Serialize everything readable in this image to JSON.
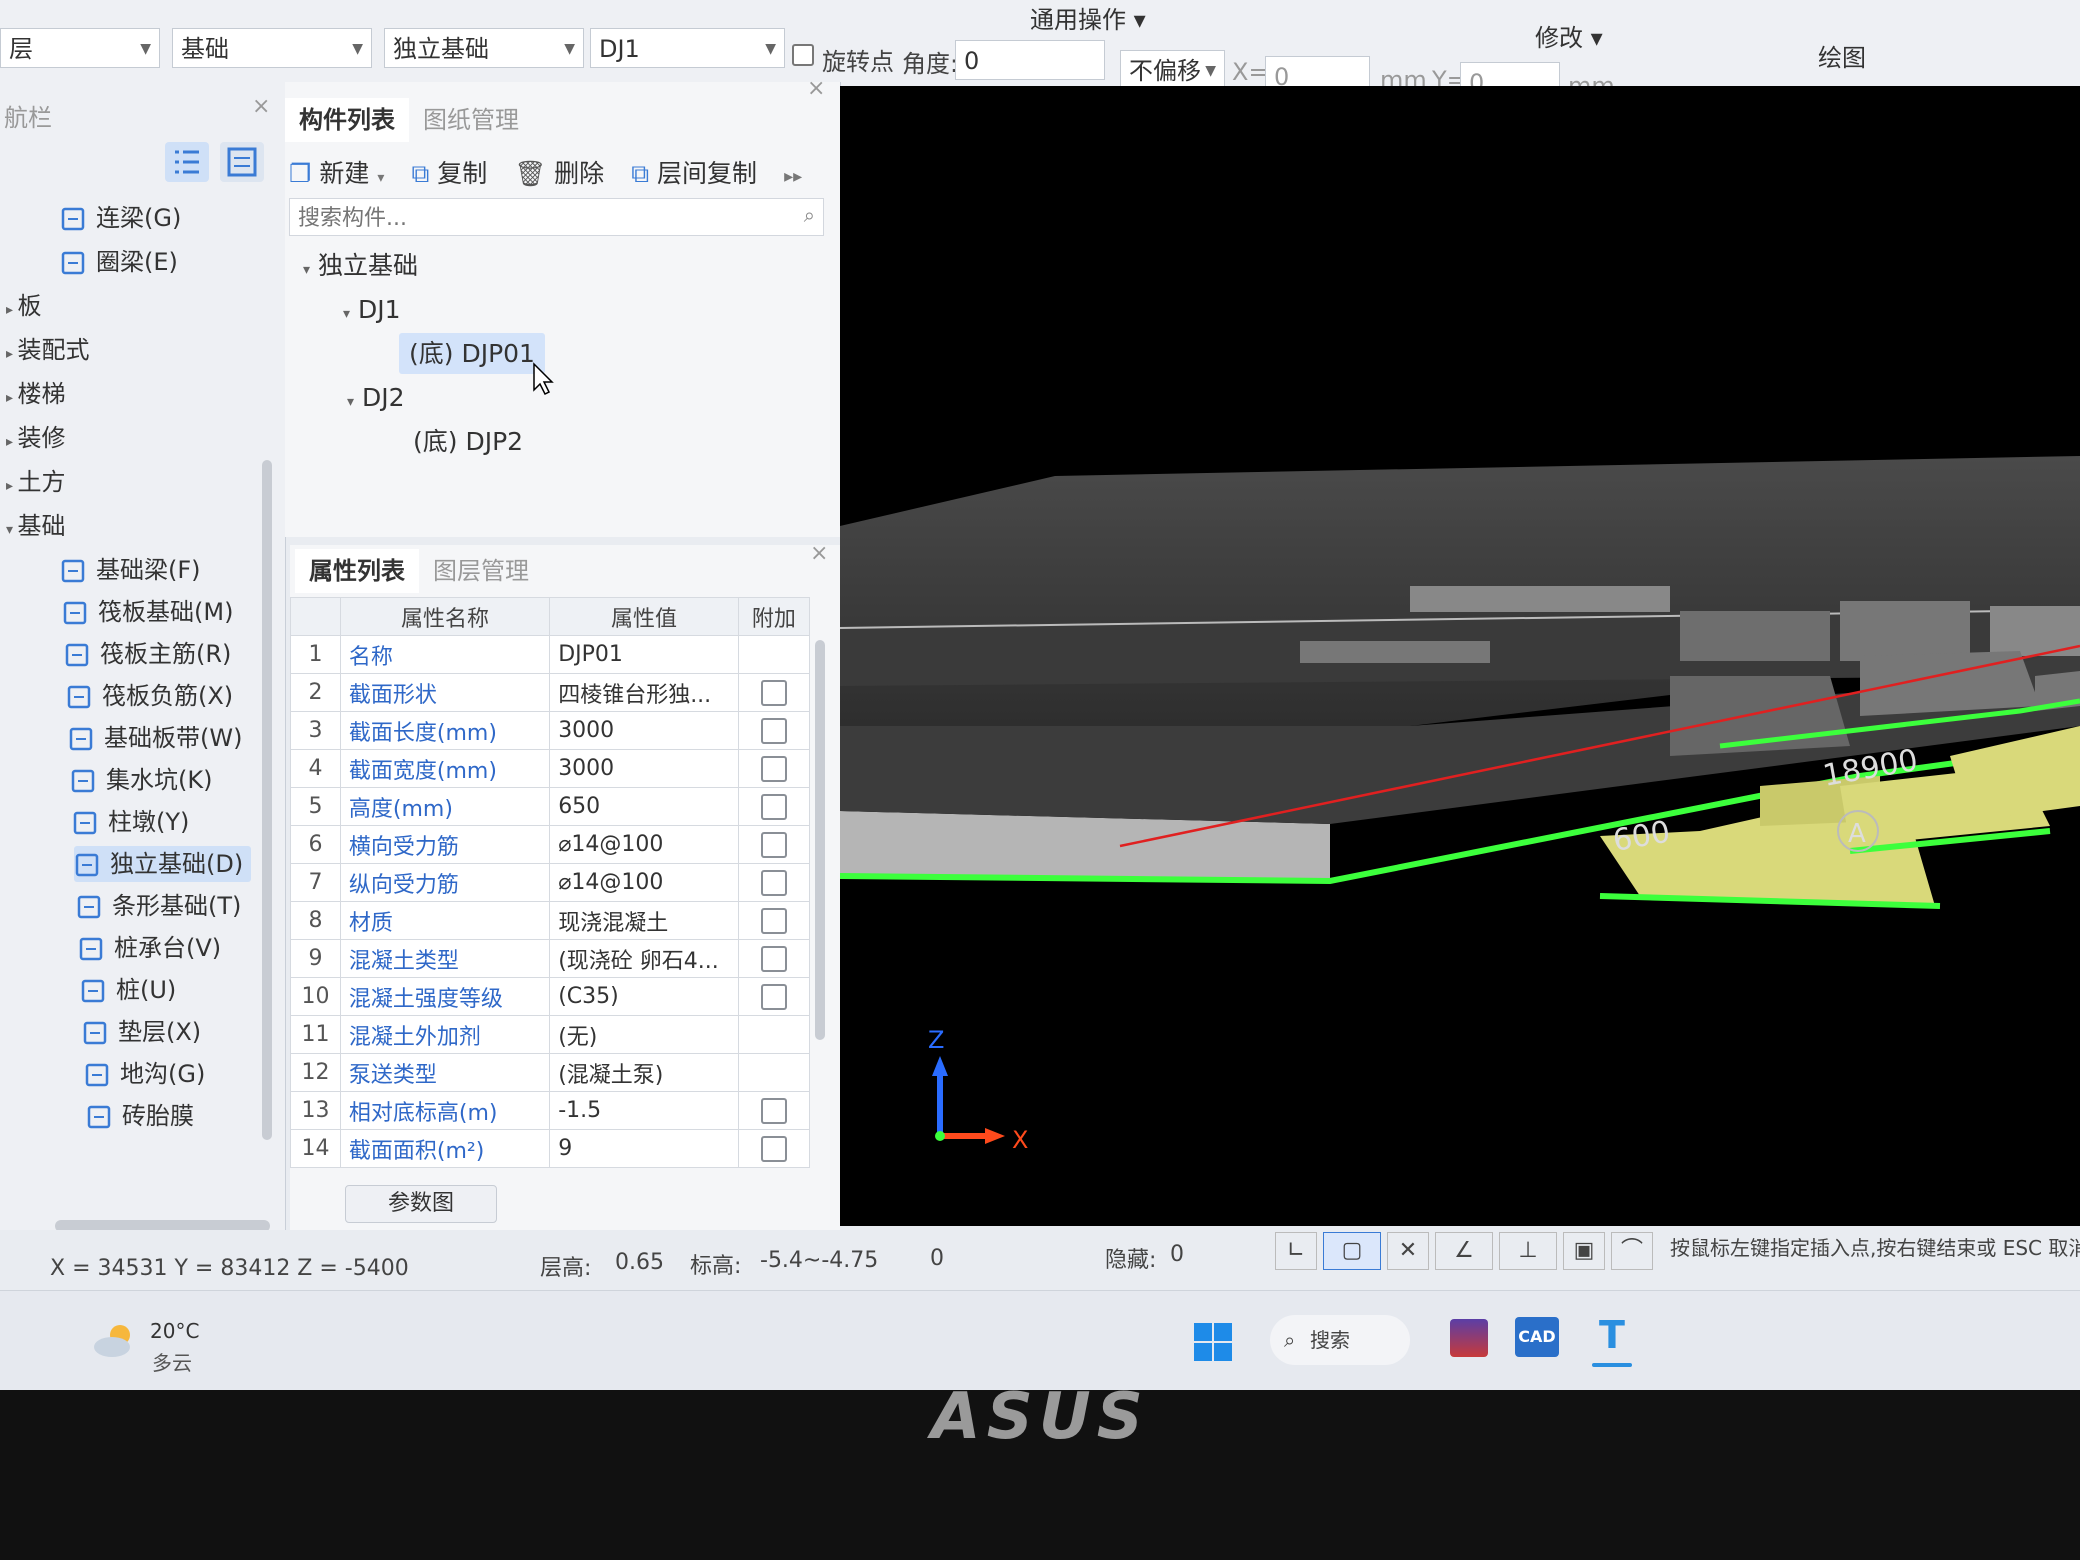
{
  "ribbon": {
    "menus": [
      "通用操作",
      "修改",
      "绘图"
    ],
    "floor_combo": "层",
    "category_combo": "基础",
    "type_combo": "独立基础",
    "component_combo": "DJ1",
    "rotate_label": "旋转点",
    "angle_label": "角度:",
    "angle_value": "0",
    "offset_combo": "不偏移",
    "x_label": "X=",
    "x_value": "0",
    "unit_mm": "mm",
    "y_label": "Y=",
    "y_value": "0"
  },
  "nav": {
    "title": "航栏",
    "items": [
      {
        "label": "连梁(G)",
        "icon": "lintel-beam-icon",
        "indent": 2
      },
      {
        "label": "圈梁(E)",
        "icon": "ring-beam-icon",
        "indent": 2
      },
      {
        "label": "板",
        "indent": 0,
        "collapsed": true
      },
      {
        "label": "装配式",
        "indent": 0,
        "collapsed": true
      },
      {
        "label": "楼梯",
        "indent": 0,
        "collapsed": true
      },
      {
        "label": "装修",
        "indent": 0,
        "collapsed": true
      },
      {
        "label": "土方",
        "indent": 0,
        "collapsed": true
      },
      {
        "label": "基础",
        "indent": 0,
        "expanded": true
      },
      {
        "label": "基础梁(F)",
        "icon": "foundation-beam-icon",
        "indent": 2
      },
      {
        "label": "筏板基础(M)",
        "icon": "raft-foundation-icon",
        "indent": 2
      },
      {
        "label": "筏板主筋(R)",
        "icon": "raft-main-rebar-icon",
        "indent": 2
      },
      {
        "label": "筏板负筋(X)",
        "icon": "raft-neg-rebar-icon",
        "indent": 2
      },
      {
        "label": "基础板带(W)",
        "icon": "foundation-strip-icon",
        "indent": 2
      },
      {
        "label": "集水坑(K)",
        "icon": "sump-pit-icon",
        "indent": 2
      },
      {
        "label": "柱墩(Y)",
        "icon": "column-pier-icon",
        "indent": 2
      },
      {
        "label": "独立基础(D)",
        "icon": "isolated-footing-icon",
        "indent": 2,
        "selected": true
      },
      {
        "label": "条形基础(T)",
        "icon": "strip-footing-icon",
        "indent": 2
      },
      {
        "label": "桩承台(V)",
        "icon": "pile-cap-icon",
        "indent": 2
      },
      {
        "label": "桩(U)",
        "icon": "pile-icon",
        "indent": 2
      },
      {
        "label": "垫层(X)",
        "icon": "cushion-icon",
        "indent": 2
      },
      {
        "label": "地沟(G)",
        "icon": "trench-icon",
        "indent": 2
      },
      {
        "label": "砖胎膜",
        "icon": "brick-mold-icon",
        "indent": 2
      }
    ]
  },
  "component_panel": {
    "tabs": [
      "构件列表",
      "图纸管理"
    ],
    "toolbar": {
      "new": "新建",
      "copy": "复制",
      "delete": "删除",
      "floor_copy": "层间复制"
    },
    "search_placeholder": "搜索构件...",
    "tree": {
      "root": "独立基础",
      "groups": [
        {
          "name": "DJ1",
          "children": [
            "(底) DJP01"
          ]
        },
        {
          "name": "DJ2",
          "children": [
            "(底) DJP2"
          ]
        }
      ]
    }
  },
  "property_panel": {
    "tabs": [
      "属性列表",
      "图层管理"
    ],
    "columns": [
      "属性名称",
      "属性值",
      "附加"
    ],
    "rows": [
      {
        "n": "1",
        "name": "名称",
        "value": "DJP01",
        "check": false
      },
      {
        "n": "2",
        "name": "截面形状",
        "value": "四棱锥台形独...",
        "check": true
      },
      {
        "n": "3",
        "name": "截面长度(mm)",
        "value": "3000",
        "check": true
      },
      {
        "n": "4",
        "name": "截面宽度(mm)",
        "value": "3000",
        "check": true
      },
      {
        "n": "5",
        "name": "高度(mm)",
        "value": "650",
        "check": true
      },
      {
        "n": "6",
        "name": "横向受力筋",
        "value": "⌀14@100",
        "check": true
      },
      {
        "n": "7",
        "name": "纵向受力筋",
        "value": "⌀14@100",
        "check": true
      },
      {
        "n": "8",
        "name": "材质",
        "value": "现浇混凝土",
        "check": true
      },
      {
        "n": "9",
        "name": "混凝土类型",
        "value": "(现浇砼 卵石4...",
        "check": true
      },
      {
        "n": "10",
        "name": "混凝土强度等级",
        "value": "(C35)",
        "check": true
      },
      {
        "n": "11",
        "name": "混凝土外加剂",
        "value": "(无)",
        "check": false
      },
      {
        "n": "12",
        "name": "泵送类型",
        "value": "(混凝土泵)",
        "check": false
      },
      {
        "n": "13",
        "name": "相对底标高(m)",
        "value": "-1.5",
        "check": true
      },
      {
        "n": "14",
        "name": "截面面积(m²)",
        "value": "9",
        "check": true
      }
    ],
    "param_button": "参数图"
  },
  "viewport": {
    "dim_labels": [
      "18900",
      "600",
      "A"
    ],
    "axis_z": "Z",
    "axis_x": "X"
  },
  "status": {
    "coords": "X = 34531 Y = 83412 Z = -5400",
    "floor_height_label": "层高:",
    "floor_height": "0.65",
    "elevation_label": "标高:",
    "elevation": "-5.4~-4.75",
    "extra": "0",
    "hidden_label": "隐藏:",
    "hidden": "0",
    "hint": "按鼠标左键指定插入点,按右键结束或 ESC 取消"
  },
  "taskbar": {
    "weather_temp": "20°C",
    "weather_desc": "多云",
    "search_label": "搜索",
    "apps": [
      "winrar-icon",
      "cad-icon",
      "t-app-icon"
    ]
  },
  "laptop": {
    "brand": "ASUS"
  },
  "colors": {
    "accent_blue": "#2f68c8",
    "viewport_bg": "#000000",
    "green_edge": "#3cff3c",
    "footing_yellow": "#d9d97a"
  }
}
